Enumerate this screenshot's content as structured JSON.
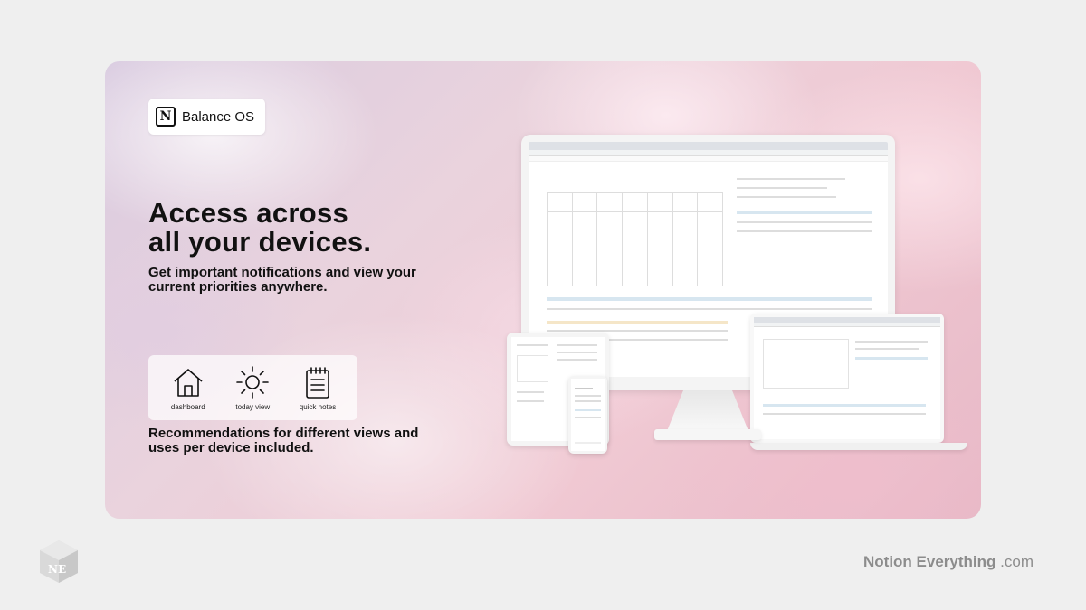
{
  "badge": {
    "title": "Balance OS",
    "logo_letter": "N"
  },
  "headline": {
    "line1": "Access across",
    "line2": "all your devices."
  },
  "subline": {
    "text": "Get important notifications and view your current priorities anywhere."
  },
  "icons": [
    {
      "icon": "house-icon",
      "label": "dashboard"
    },
    {
      "icon": "sun-icon",
      "label": "today view"
    },
    {
      "icon": "notepad-icon",
      "label": "quick notes"
    }
  ],
  "recommend": {
    "text": "Recommendations for different views and uses per device included."
  },
  "footer": {
    "logo_letters": "NE",
    "brand_bold": "Notion Everything",
    "brand_suffix": ".com"
  },
  "colors": {
    "background": "#efefef",
    "text": "#111111",
    "footer_text": "#8c8c8c",
    "card_pink": "#f0c9d3",
    "card_lavender": "#d9cbe0"
  }
}
